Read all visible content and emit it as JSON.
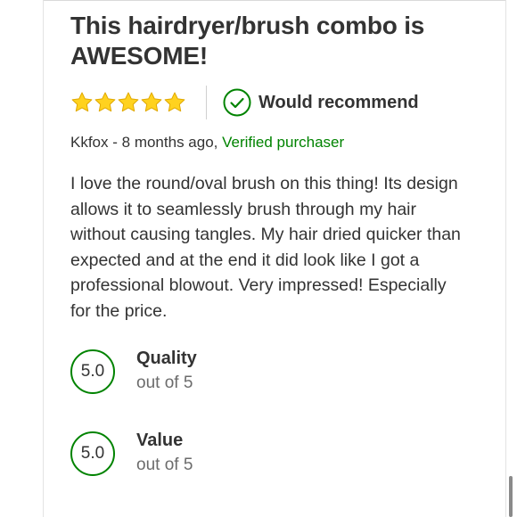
{
  "review": {
    "title": "This hairdryer/brush combo is AWESOME!",
    "rating": {
      "value": 5,
      "max": 5,
      "icon": "star-icon",
      "color": "#FFD21F"
    },
    "recommend": {
      "label": "Would recommend",
      "icon": "check-circle-icon",
      "color": "#008300"
    },
    "author": "Kkfox",
    "separator": " - ",
    "time_ago": "8 months ago,",
    "verified_label": "Verified purchaser",
    "body": "I love the round/oval brush on this thing! Its design allows it to seamlessly brush through my hair without causing tangles. My hair dried quicker than expected and at the end it did look like I got a professional blowout. Very impressed! Especially for the price."
  },
  "scores": [
    {
      "value": "5.0",
      "label": "Quality",
      "suffix": "out of 5"
    },
    {
      "value": "5.0",
      "label": "Value",
      "suffix": "out of 5"
    }
  ],
  "colors": {
    "accent_green": "#008300",
    "star_fill": "#FFD21F",
    "text": "#333333",
    "muted": "#6b6b6b"
  }
}
